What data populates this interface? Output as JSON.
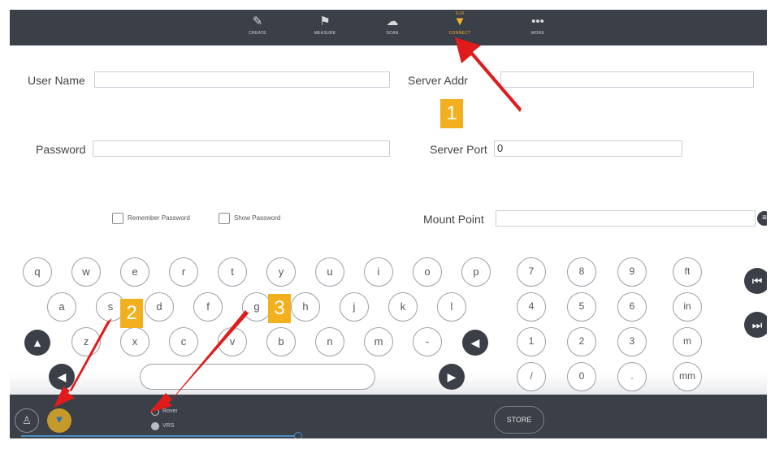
{
  "toolbar": {
    "items": [
      {
        "label": "CREATE",
        "icon": "pencil-icon"
      },
      {
        "label": "MEASURE",
        "icon": "flag-icon"
      },
      {
        "label": "SCAN",
        "icon": "cloud-icon"
      },
      {
        "label": "CONNECT",
        "icon": "gnss-receiver-icon",
        "active": true,
        "badge": "S:2X"
      },
      {
        "label": "MORE",
        "icon": "more-icon"
      }
    ]
  },
  "form": {
    "user_name_label": "User Name",
    "user_name_value": "",
    "password_label": "Password",
    "password_value": "",
    "server_address_label": "Server Addr",
    "server_address_value": "",
    "server_port_label": "Server Port",
    "server_port_value": "0",
    "mount_point_label": "Mount Point",
    "mount_point_value": "",
    "remember_password_label": "Remember Password",
    "show_password_label": "Show Password"
  },
  "keyboard": {
    "row1": [
      "q",
      "w",
      "e",
      "r",
      "t",
      "y",
      "u",
      "i",
      "o",
      "p"
    ],
    "row2": [
      "a",
      "s",
      "d",
      "f",
      "g",
      "h",
      "j",
      "k",
      "l"
    ],
    "row3": [
      "z",
      "x",
      "c",
      "v",
      "b",
      "n",
      "m",
      "-"
    ],
    "numpad": [
      [
        "7",
        "8",
        "9",
        "ft"
      ],
      [
        "4",
        "5",
        "6",
        "in"
      ],
      [
        "1",
        "2",
        "3",
        "m"
      ],
      [
        "/",
        "0",
        ".",
        "mm"
      ]
    ]
  },
  "bottom": {
    "radio1_label": "Rover",
    "radio2_label": "VRS",
    "store_label": "STORE"
  },
  "annotations": [
    "1",
    "2",
    "3"
  ],
  "colors": {
    "bar": "#3b3f48",
    "accent": "#f0b429",
    "arrow": "#e01b1b",
    "badge": "#f2b01e"
  }
}
